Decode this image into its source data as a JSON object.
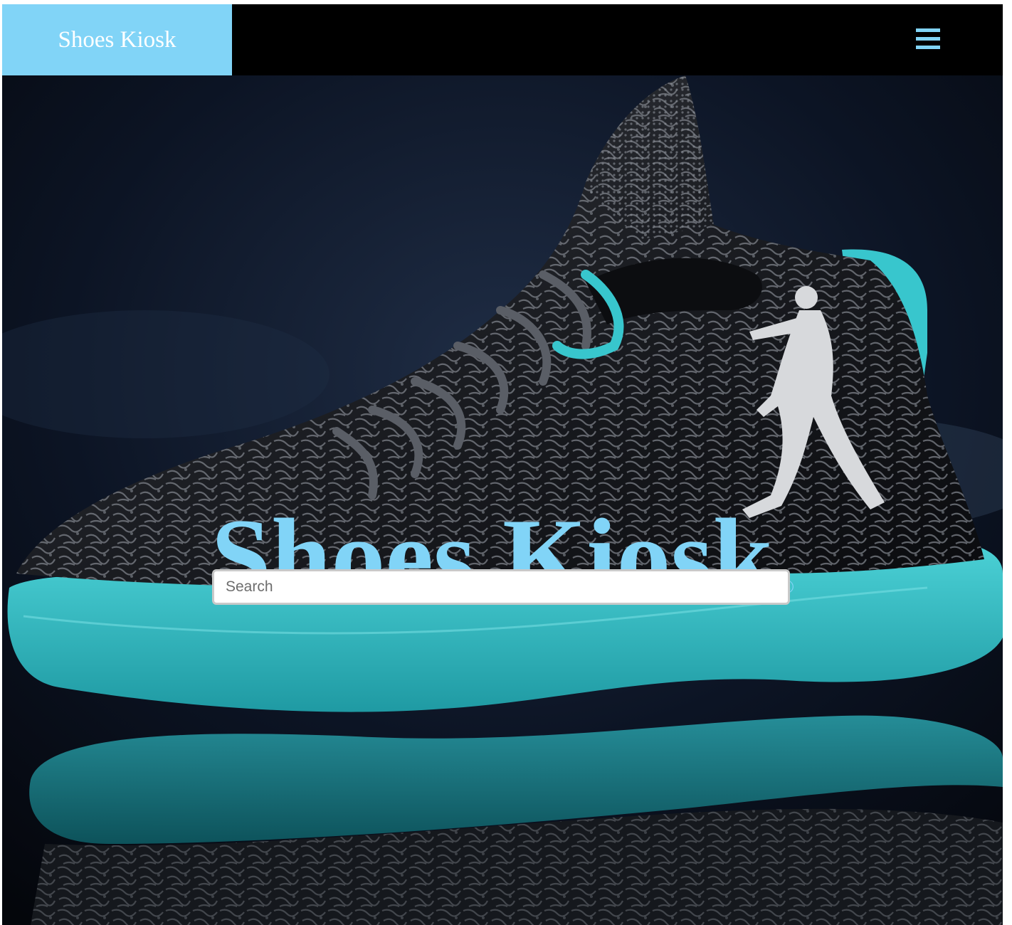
{
  "navbar": {
    "brand": "Shoes Kiosk",
    "menu_icon": "hamburger-menu-icon",
    "brand_color": "#81d4f7",
    "background_color": "#000000"
  },
  "hero": {
    "title": "Shoes Kiosk",
    "copyright_mark": "©",
    "title_color": "#81d4f7",
    "image": "sneaker-photo",
    "sole_color": "#35b9c1"
  },
  "search": {
    "placeholder": "Search",
    "value": ""
  }
}
